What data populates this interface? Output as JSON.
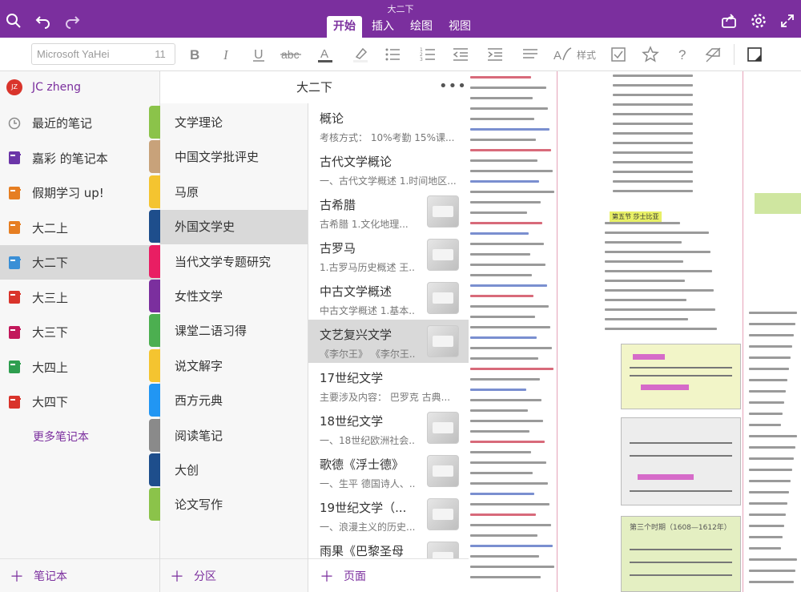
{
  "app": {
    "document_title": "大二下",
    "tabs": [
      {
        "label": "开始",
        "active": true
      },
      {
        "label": "插入",
        "active": false
      },
      {
        "label": "绘图",
        "active": false
      },
      {
        "label": "视图",
        "active": false
      }
    ],
    "toolbar_icons": [
      "search-icon",
      "undo-icon",
      "redo-icon",
      "share-icon",
      "gear-icon",
      "expand-icon"
    ],
    "accent_color": "#7b2f9e"
  },
  "ribbon": {
    "font_name": "Microsoft YaHei",
    "font_size": "11",
    "style_label": "样式",
    "buttons": [
      "bold-icon",
      "italic-icon",
      "underline-icon",
      "strikethrough-icon",
      "font-color-icon",
      "highlight-icon",
      "bullet-list-icon",
      "numbered-list-icon",
      "outdent-icon",
      "indent-icon",
      "align-icon",
      "styles-icon",
      "checkbox-icon",
      "star-icon",
      "help-icon",
      "clear-format-icon",
      "dock-icon"
    ]
  },
  "notebooks": {
    "user": {
      "initials": "JZ",
      "name": "JC zheng"
    },
    "items": [
      {
        "label": "最近的笔记",
        "color": "#8a8a8a",
        "icon": "clock-icon",
        "active": false
      },
      {
        "label": "嘉彩 的笔记本",
        "color": "#6b35a8",
        "icon": "notebook-icon",
        "active": false
      },
      {
        "label": "假期学习 up!",
        "color": "#e67e22",
        "icon": "notebook-icon",
        "active": false
      },
      {
        "label": "大二上",
        "color": "#e67e22",
        "icon": "notebook-icon",
        "active": false
      },
      {
        "label": "大二下",
        "color": "#3a8fd6",
        "icon": "notebook-icon",
        "active": true
      },
      {
        "label": "大三上",
        "color": "#d9342b",
        "icon": "notebook-icon",
        "active": false
      },
      {
        "label": "大三下",
        "color": "#c2185b",
        "icon": "notebook-icon",
        "active": false
      },
      {
        "label": "大四上",
        "color": "#2e9e4f",
        "icon": "notebook-icon",
        "active": false
      },
      {
        "label": "大四下",
        "color": "#d9342b",
        "icon": "notebook-icon",
        "active": false
      }
    ],
    "more_label": "更多笔记本",
    "add_label": "笔记本"
  },
  "sections": {
    "header": "大二下",
    "items": [
      {
        "label": "文学理论",
        "color": "#8bc34a",
        "active": false
      },
      {
        "label": "中国文学批评史",
        "color": "#c8a27a",
        "active": false
      },
      {
        "label": "马原",
        "color": "#f4c430",
        "active": false
      },
      {
        "label": "外国文学史",
        "color": "#1e4e8c",
        "active": true
      },
      {
        "label": "当代文学专题研究",
        "color": "#e91e63",
        "active": false
      },
      {
        "label": "女性文学",
        "color": "#7b2f9e",
        "active": false
      },
      {
        "label": "课堂二语习得",
        "color": "#4caf50",
        "active": false
      },
      {
        "label": "说文解字",
        "color": "#f4c430",
        "active": false
      },
      {
        "label": "西方元典",
        "color": "#2196f3",
        "active": false
      },
      {
        "label": "阅读笔记",
        "color": "#8a8a8a",
        "active": false
      },
      {
        "label": "大创",
        "color": "#1e4e8c",
        "active": false
      },
      {
        "label": "论文写作",
        "color": "#8bc34a",
        "active": false
      }
    ],
    "add_label": "分区"
  },
  "pages": {
    "items": [
      {
        "title": "概论",
        "preview": "考核方式：  10%考勤  15%课...",
        "thumb": false,
        "active": false
      },
      {
        "title": "古代文学概论",
        "preview": "一、古代文学概述  1.时间地区...",
        "thumb": false,
        "active": false
      },
      {
        "title": "古希腊",
        "preview": "古希腊  1.文化地理...",
        "thumb": true,
        "active": false
      },
      {
        "title": "古罗马",
        "preview": "1.古罗马历史概述  王...",
        "thumb": true,
        "active": false
      },
      {
        "title": "中古文学概述",
        "preview": "中古文学概述  1.基本...",
        "thumb": true,
        "active": false
      },
      {
        "title": "文艺复兴文学",
        "preview": "《李尔王》  《李尔王...",
        "thumb": true,
        "active": true
      },
      {
        "title": "17世纪文学",
        "preview": "主要涉及内容：  巴罗克  古典...",
        "thumb": false,
        "active": false
      },
      {
        "title": "18世纪文学",
        "preview": "一、18世纪欧洲社会...",
        "thumb": true,
        "active": false
      },
      {
        "title": "歌德《浮士德》",
        "preview": "一、生平  德国诗人、...",
        "thumb": true,
        "active": false
      },
      {
        "title": "19世纪文学（...",
        "preview": "一、浪漫主义的历史...",
        "thumb": true,
        "active": false
      },
      {
        "title": "雨果《巴黎圣母",
        "preview": "",
        "thumb": true,
        "active": false
      }
    ],
    "add_label": "页面"
  },
  "canvas": {
    "headings": [
      {
        "text": "第五节  莎士比亚"
      },
      {
        "text": "第三个时期（1608—1612年）"
      }
    ]
  }
}
